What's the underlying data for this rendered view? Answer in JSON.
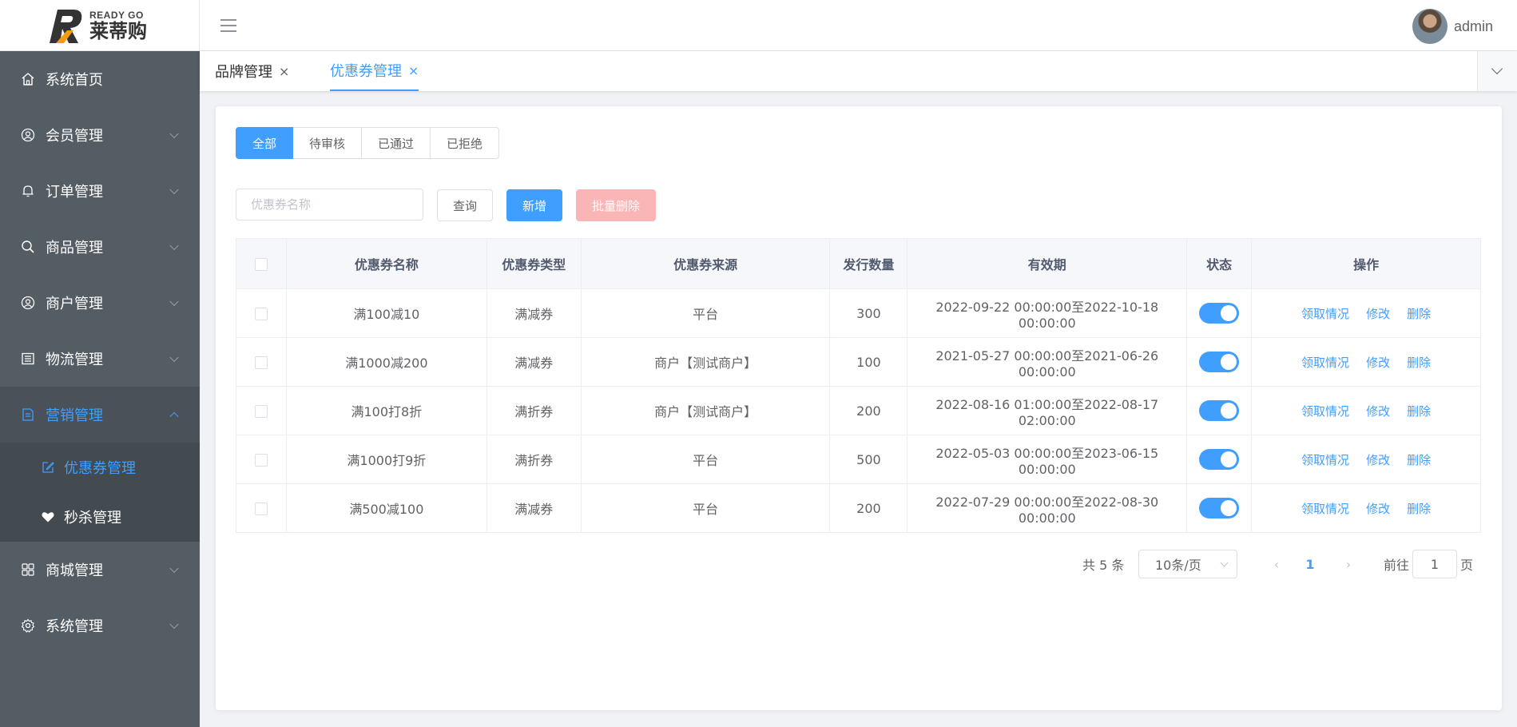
{
  "brand": {
    "logo_en": "READY GO",
    "logo_cn": "莱蒂购",
    "accent": "#409eff"
  },
  "header": {
    "username": "admin"
  },
  "sidebar": {
    "items": [
      {
        "label": "系统首页",
        "icon": "home-icon"
      },
      {
        "label": "会员管理",
        "icon": "user-icon"
      },
      {
        "label": "订单管理",
        "icon": "bell-icon"
      },
      {
        "label": "商品管理",
        "icon": "search-icon"
      },
      {
        "label": "商户管理",
        "icon": "user-circle-icon"
      },
      {
        "label": "物流管理",
        "icon": "list-icon"
      },
      {
        "label": "营销管理",
        "icon": "document-icon"
      },
      {
        "label": "商城管理",
        "icon": "grid-icon"
      },
      {
        "label": "系统管理",
        "icon": "gear-icon"
      }
    ],
    "sub_items": [
      {
        "label": "优惠券管理",
        "icon": "edit-icon"
      },
      {
        "label": "秒杀管理",
        "icon": "heart-icon"
      }
    ]
  },
  "tabs": [
    {
      "label": "品牌管理",
      "close": "×"
    },
    {
      "label": "优惠券管理",
      "close": "×"
    }
  ],
  "status_tabs": [
    "全部",
    "待审核",
    "已通过",
    "已拒绝"
  ],
  "toolbar": {
    "search_placeholder": "优惠券名称",
    "query_label": "查询",
    "add_label": "新增",
    "batch_delete_label": "批量删除"
  },
  "table": {
    "headers": [
      "优惠券名称",
      "优惠券类型",
      "优惠券来源",
      "发行数量",
      "有效期",
      "状态",
      "操作"
    ],
    "actions": [
      "领取情况",
      "修改",
      "删除"
    ],
    "rows": [
      {
        "name": "满100减10",
        "type": "满减券",
        "source": "平台",
        "count": "300",
        "period": "2022-09-22 00:00:00至2022-10-18 00:00:00",
        "enabled": true
      },
      {
        "name": "满1000减200",
        "type": "满减券",
        "source": "商户【测试商户】",
        "count": "100",
        "period": "2021-05-27 00:00:00至2021-06-26 00:00:00",
        "enabled": true
      },
      {
        "name": "满100打8折",
        "type": "满折券",
        "source": "商户【测试商户】",
        "count": "200",
        "period": "2022-08-16 01:00:00至2022-08-17 02:00:00",
        "enabled": true
      },
      {
        "name": "满1000打9折",
        "type": "满折券",
        "source": "平台",
        "count": "500",
        "period": "2022-05-03 00:00:00至2023-06-15 00:00:00",
        "enabled": true
      },
      {
        "name": "满500减100",
        "type": "满减券",
        "source": "平台",
        "count": "200",
        "period": "2022-07-29 00:00:00至2022-08-30 00:00:00",
        "enabled": true
      }
    ]
  },
  "pagination": {
    "total_text": "共 5 条",
    "page_size": "10条/页",
    "prev": "‹",
    "current": "1",
    "next": "›",
    "goto_label": "前往",
    "goto_value": "1",
    "page_suffix": "页"
  }
}
